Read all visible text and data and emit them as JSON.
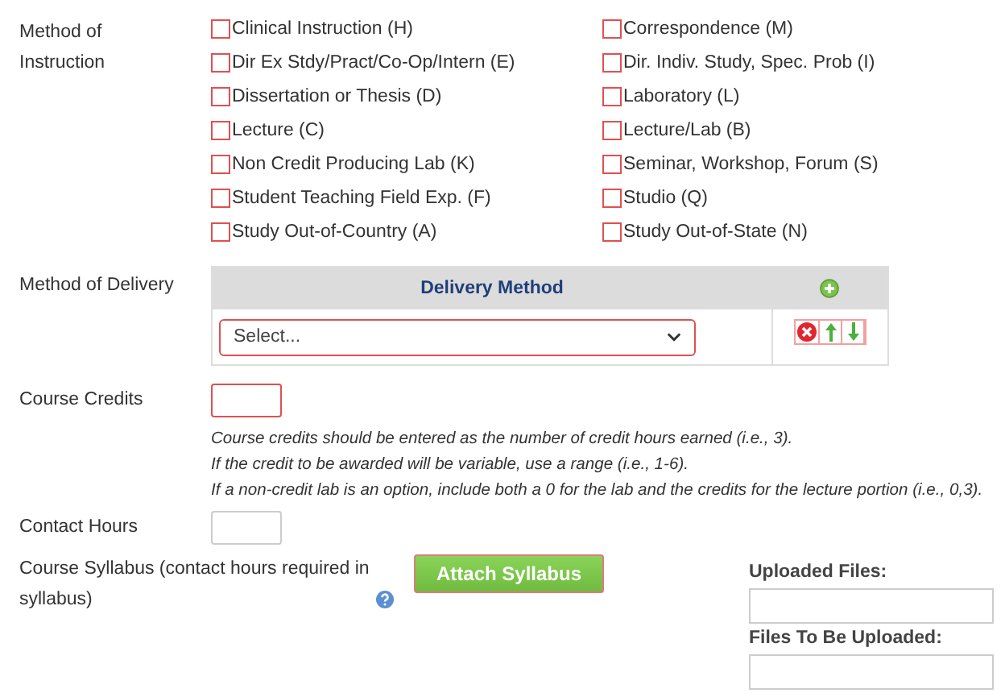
{
  "instruction": {
    "label": "Method of Instruction",
    "options": [
      {
        "label": "Clinical Instruction (H)",
        "checked": false
      },
      {
        "label": "Correspondence (M)",
        "checked": false
      },
      {
        "label": "Dir Ex Stdy/Pract/Co-Op/Intern (E)",
        "checked": false
      },
      {
        "label": "Dir. Indiv. Study, Spec. Prob (I)",
        "checked": false
      },
      {
        "label": "Dissertation or Thesis (D)",
        "checked": false
      },
      {
        "label": "Laboratory (L)",
        "checked": false
      },
      {
        "label": "Lecture (C)",
        "checked": false
      },
      {
        "label": "Lecture/Lab (B)",
        "checked": false
      },
      {
        "label": "Non Credit Producing Lab (K)",
        "checked": false
      },
      {
        "label": "Seminar, Workshop, Forum (S)",
        "checked": false
      },
      {
        "label": "Student Teaching Field Exp. (F)",
        "checked": false
      },
      {
        "label": "Studio (Q)",
        "checked": false
      },
      {
        "label": "Study Out-of-Country (A)",
        "checked": false
      },
      {
        "label": "Study Out-of-State (N)",
        "checked": false
      }
    ]
  },
  "delivery": {
    "label": "Method of Delivery",
    "column": "Delivery Method",
    "rows": [
      {
        "placeholder": "Select..."
      }
    ]
  },
  "credits": {
    "label": "Course Credits",
    "help": [
      "Course credits should be entered as the number of credit hours earned (i.e., 3).",
      "If the credit to be awarded will be variable, use a range (i.e., 1-6).",
      "If a non-credit lab is an option, include both a 0 for the lab and the credits for the lecture portion (i.e., 0,3)."
    ]
  },
  "contact": {
    "label": "Contact Hours"
  },
  "syllabus": {
    "label": "Course Syllabus (contact hours required in syllabus)",
    "button": "Attach Syllabus",
    "uploaded_label": "Uploaded Files:",
    "to_upload_label": "Files To Be Uploaded:"
  }
}
